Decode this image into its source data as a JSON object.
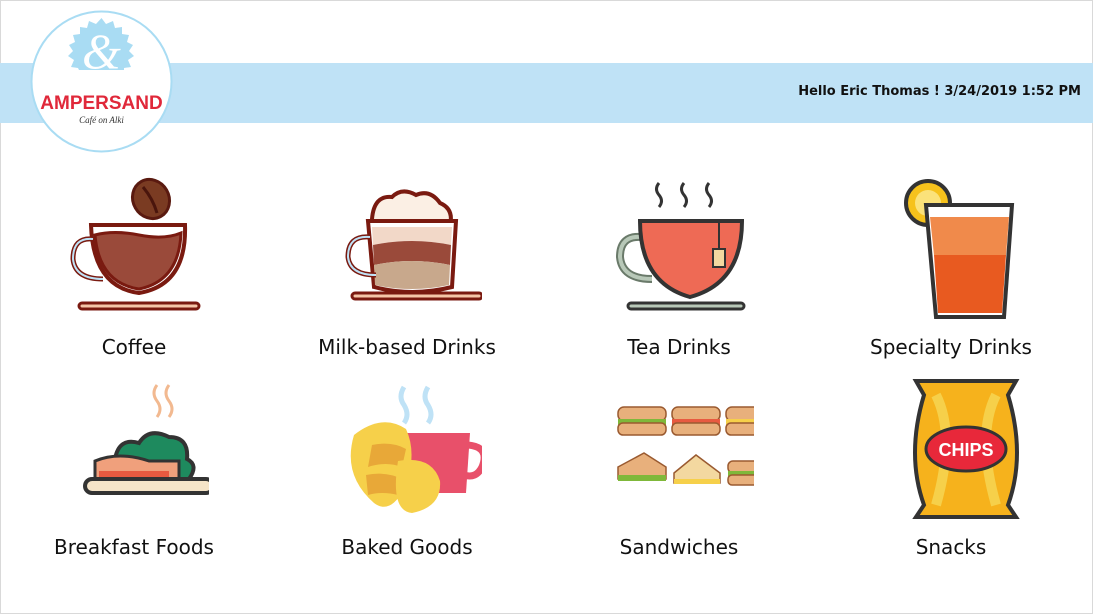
{
  "header": {
    "greeting": "Hello Eric Thomas ! 3/24/2019 1:52 PM",
    "logo": {
      "mark": "&",
      "name": "AMPERSAND",
      "tagline": "Café on Alki"
    }
  },
  "colors": {
    "header_band": "#bfe2f6",
    "logo_red": "#e0283a",
    "logo_blue": "#a9dcf3"
  },
  "categories": [
    {
      "label": "Coffee",
      "icon": "coffee-cup-icon"
    },
    {
      "label": "Milk-based Drinks",
      "icon": "latte-cup-icon"
    },
    {
      "label": "Tea Drinks",
      "icon": "tea-cup-icon"
    },
    {
      "label": "Specialty Drinks",
      "icon": "iced-drink-icon"
    },
    {
      "label": "Breakfast Foods",
      "icon": "breakfast-plate-icon"
    },
    {
      "label": "Baked Goods",
      "icon": "croissant-coffee-icon"
    },
    {
      "label": "Sandwiches",
      "icon": "sandwiches-icon"
    },
    {
      "label": "Snacks",
      "icon": "chips-bag-icon"
    }
  ]
}
